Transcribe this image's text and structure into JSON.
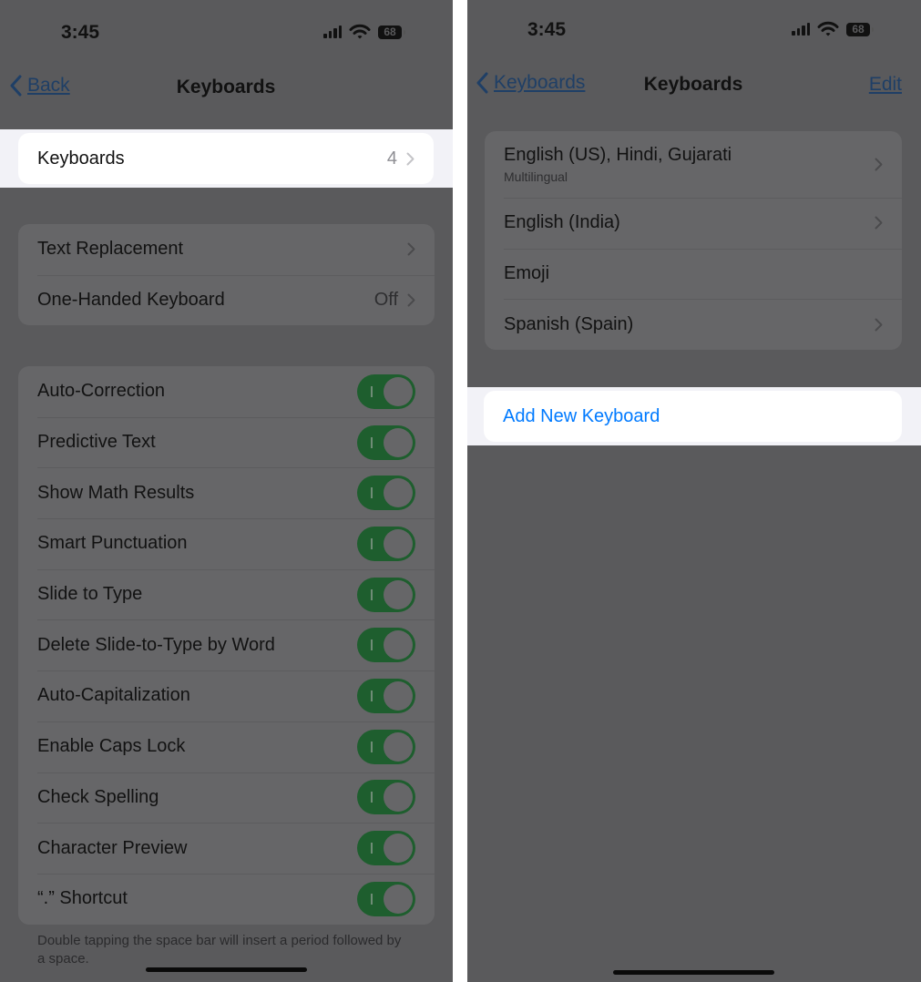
{
  "left": {
    "status": {
      "time": "3:45",
      "battery": "68"
    },
    "nav": {
      "back_label": "Back",
      "title": "Keyboards"
    },
    "keyboards_row": {
      "label": "Keyboards",
      "value": "4"
    },
    "group1": [
      {
        "label": "Text Replacement",
        "value": ""
      },
      {
        "label": "One-Handed Keyboard",
        "value": "Off"
      }
    ],
    "toggles": [
      {
        "label": "Auto-Correction",
        "on": true
      },
      {
        "label": "Predictive Text",
        "on": true
      },
      {
        "label": "Show Math Results",
        "on": true
      },
      {
        "label": "Smart Punctuation",
        "on": true
      },
      {
        "label": "Slide to Type",
        "on": true
      },
      {
        "label": "Delete Slide-to-Type by Word",
        "on": true
      },
      {
        "label": "Auto-Capitalization",
        "on": true
      },
      {
        "label": "Enable Caps Lock",
        "on": true
      },
      {
        "label": "Check Spelling",
        "on": true
      },
      {
        "label": "Character Preview",
        "on": true
      },
      {
        "label": "“.” Shortcut",
        "on": true
      }
    ],
    "footnote": "Double tapping the space bar will insert a period followed by a space."
  },
  "right": {
    "status": {
      "time": "3:45",
      "battery": "68"
    },
    "nav": {
      "back_label": "Keyboards",
      "title": "Keyboards",
      "edit_label": "Edit"
    },
    "keyboards": [
      {
        "label": "English (US), Hindi, Gujarati",
        "sublabel": "Multilingual",
        "chevron": true
      },
      {
        "label": "English (India)",
        "chevron": true
      },
      {
        "label": "Emoji",
        "chevron": false
      },
      {
        "label": "Spanish (Spain)",
        "chevron": true
      }
    ],
    "add_keyboard_label": "Add New Keyboard"
  },
  "colors": {
    "dim_background": "#5a5a5c",
    "highlight_background": "#f2f2f7",
    "link_blue": "#007aff",
    "toggle_on_dimmed": "#1e5e2e"
  },
  "icons": [
    "chevron-left-icon",
    "chevron-right-icon",
    "signal-icon",
    "wifi-icon",
    "battery-icon"
  ]
}
